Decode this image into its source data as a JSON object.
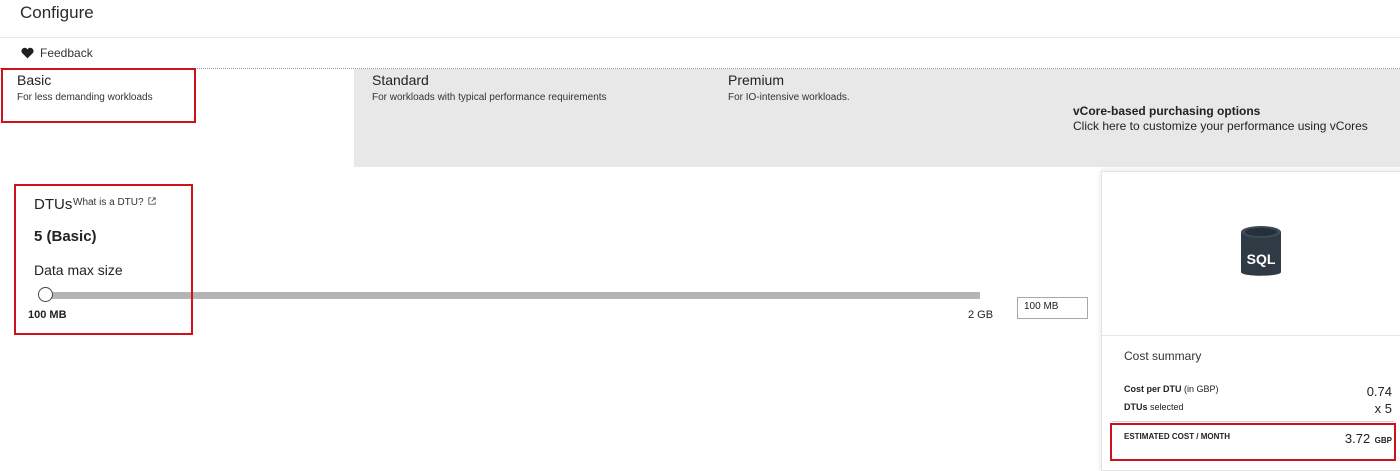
{
  "page": {
    "title": "Configure",
    "feedback": "Feedback"
  },
  "tiers": [
    {
      "name": "Basic",
      "desc": "For less demanding workloads"
    },
    {
      "name": "Standard",
      "desc": "For workloads with typical performance requirements"
    },
    {
      "name": "Premium",
      "desc": "For IO-intensive workloads."
    }
  ],
  "vcore": {
    "title": "vCore-based purchasing options",
    "desc": "Click here to customize your performance using vCores"
  },
  "dtu": {
    "label": "DTUs",
    "link": "What is a DTU?",
    "value": "5 (Basic)",
    "max_size_label": "Data max size",
    "slider_min": "100 MB",
    "slider_max": "2 GB",
    "slider_fraction": 0,
    "input_value": "100 MB"
  },
  "cost": {
    "icon_text": "SQL",
    "title": "Cost summary",
    "per_dtu_label_bold": "Cost per DTU",
    "per_dtu_label_rest": " (in GBP)",
    "per_dtu_value": "0.74",
    "dtus_label_bold": "DTUs",
    "dtus_label_rest": " selected",
    "dtus_value": "x 5",
    "estimated_label": "ESTIMATED COST / MONTH",
    "estimated_value": "3.72",
    "currency": "GBP"
  },
  "colors": {
    "highlight": "#d0111b",
    "tier_inactive_bg": "#e8e8e8",
    "sql_icon": "#2f3a45"
  }
}
